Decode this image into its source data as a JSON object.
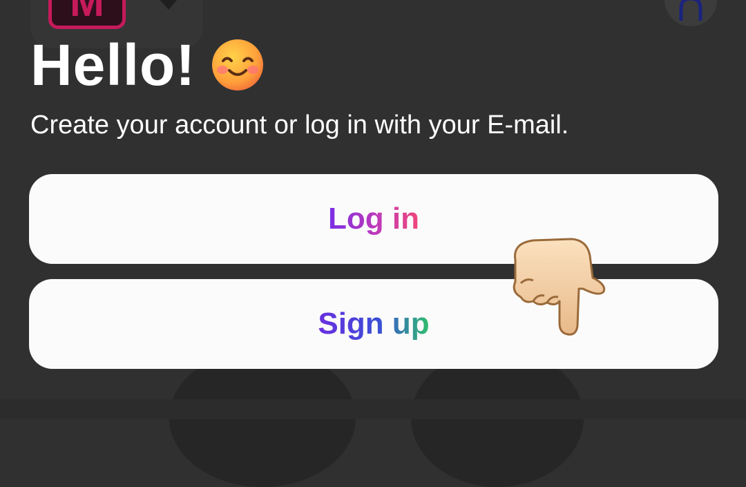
{
  "header": {
    "logo_text": "M"
  },
  "greeting": {
    "title": "Hello!",
    "subtitle": "Create your account or log in with your E-mail."
  },
  "actions": {
    "login_label": "Log in",
    "signup_label": "Sign up"
  },
  "icons": {
    "logo": "app-logo-icon",
    "caret": "chevron-down-icon",
    "profile": "profile-icon",
    "emoji": "smiling-face-icon",
    "hand": "hand-pointing-down-icon"
  },
  "colors": {
    "background": "#303030",
    "button_bg": "#fbfbfb",
    "login_gradient": [
      "#7a2ee6",
      "#c03ab8",
      "#f0477a"
    ],
    "signup_gradient": [
      "#6b2ee0",
      "#3a4fd6",
      "#2fbf6d"
    ],
    "logo_accent": "#c61a5a"
  }
}
